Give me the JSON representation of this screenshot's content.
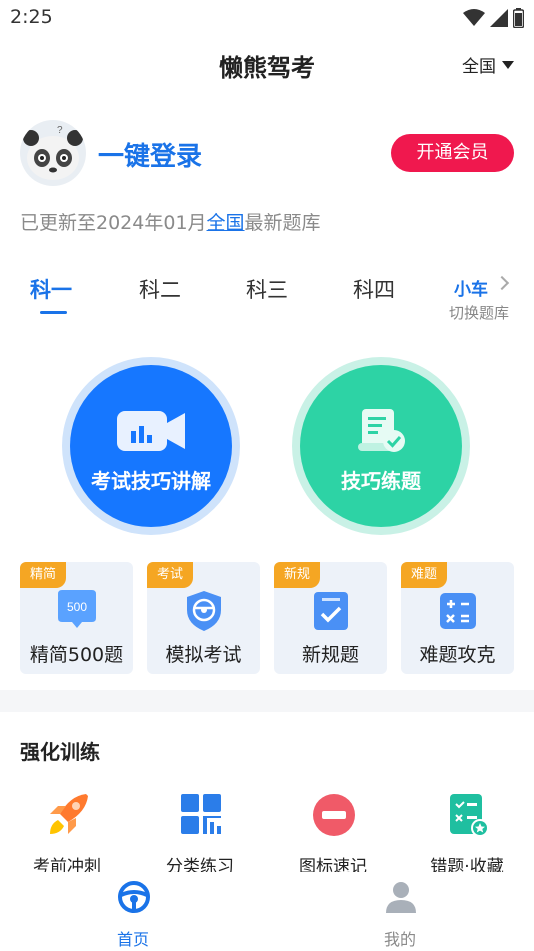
{
  "status_bar": {
    "time": "2:25",
    "icons": [
      "wifi-icon",
      "signal-icon",
      "battery-icon"
    ]
  },
  "header": {
    "title": "懒熊驾考",
    "region": "全国"
  },
  "user": {
    "login_label": "一键登录",
    "vip_label": "开通会员"
  },
  "update": {
    "prefix": "已更新至2024年01月",
    "region": "全国",
    "suffix": "最新题库"
  },
  "subject_tabs": [
    {
      "label": "科一",
      "active": true
    },
    {
      "label": "科二",
      "active": false
    },
    {
      "label": "科三",
      "active": false
    },
    {
      "label": "科四",
      "active": false
    }
  ],
  "car_type": {
    "label": "小车",
    "switch_label": "切换题库"
  },
  "main_buttons": [
    {
      "label": "考试技巧讲解",
      "icon": "video-camera-icon",
      "color": "#1677ff"
    },
    {
      "label": "技巧练题",
      "icon": "scroll-check-icon",
      "color": "#2dd3a5"
    }
  ],
  "cards": [
    {
      "tag": "精简",
      "label": "精简500题",
      "icon": "chat-500-icon",
      "badge_text": "500"
    },
    {
      "tag": "考试",
      "label": "模拟考试",
      "icon": "shield-steering-icon"
    },
    {
      "tag": "新规",
      "label": "新规题",
      "icon": "checklist-icon"
    },
    {
      "tag": "难题",
      "label": "难题攻克",
      "icon": "calculator-icon"
    }
  ],
  "training": {
    "title": "强化训练",
    "items": [
      {
        "label": "考前冲刺",
        "icon": "rocket-icon"
      },
      {
        "label": "分类练习",
        "icon": "grid-chart-icon"
      },
      {
        "label": "图标速记",
        "icon": "no-entry-icon"
      },
      {
        "label": "错题·收藏",
        "icon": "list-star-icon"
      }
    ]
  },
  "bottom_nav": [
    {
      "label": "首页",
      "icon": "steering-wheel-icon",
      "active": true
    },
    {
      "label": "我的",
      "icon": "user-icon",
      "active": false
    }
  ],
  "colors": {
    "primary": "#1a73e8",
    "vip": "#f0184e",
    "green": "#2dd3a5",
    "tag": "#f5a623"
  }
}
